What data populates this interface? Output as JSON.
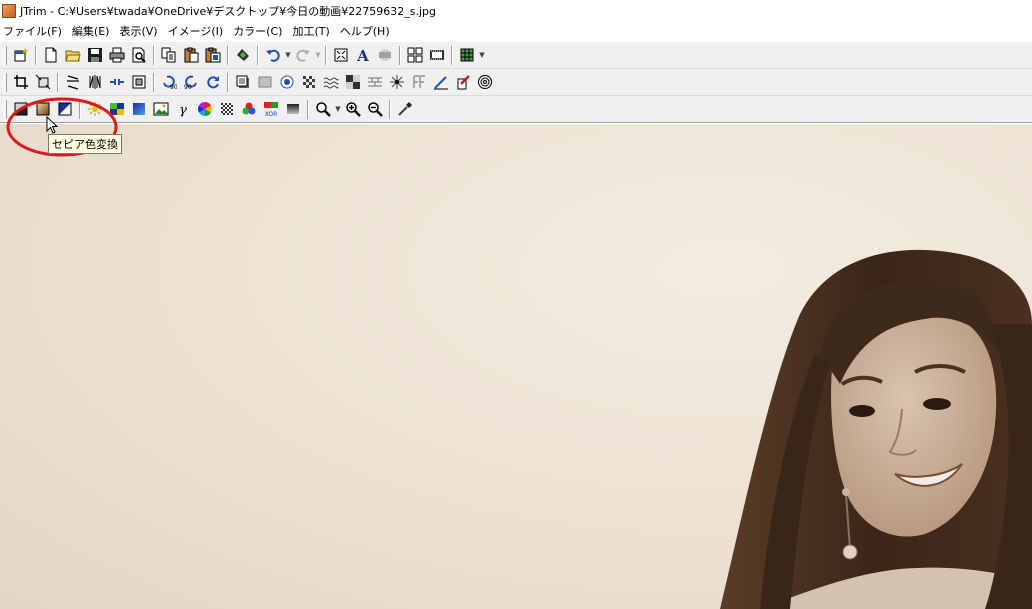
{
  "window": {
    "title": "JTrim - C:¥Users¥twada¥OneDrive¥デスクトップ¥今日の動画¥22759632_s.jpg"
  },
  "menu": [
    {
      "label": "ファイル(F)"
    },
    {
      "label": "編集(E)"
    },
    {
      "label": "表示(V)"
    },
    {
      "label": "イメージ(I)"
    },
    {
      "label": "カラー(C)"
    },
    {
      "label": "加工(T)"
    },
    {
      "label": "ヘルプ(H)"
    }
  ],
  "tooltip": {
    "text": "セピア色変換"
  },
  "colors": {
    "sepia_light": "#f1e8dc",
    "sepia_dark": "#3a2618",
    "highlight": "#e01818",
    "tooltip_bg": "#ffffe1"
  }
}
